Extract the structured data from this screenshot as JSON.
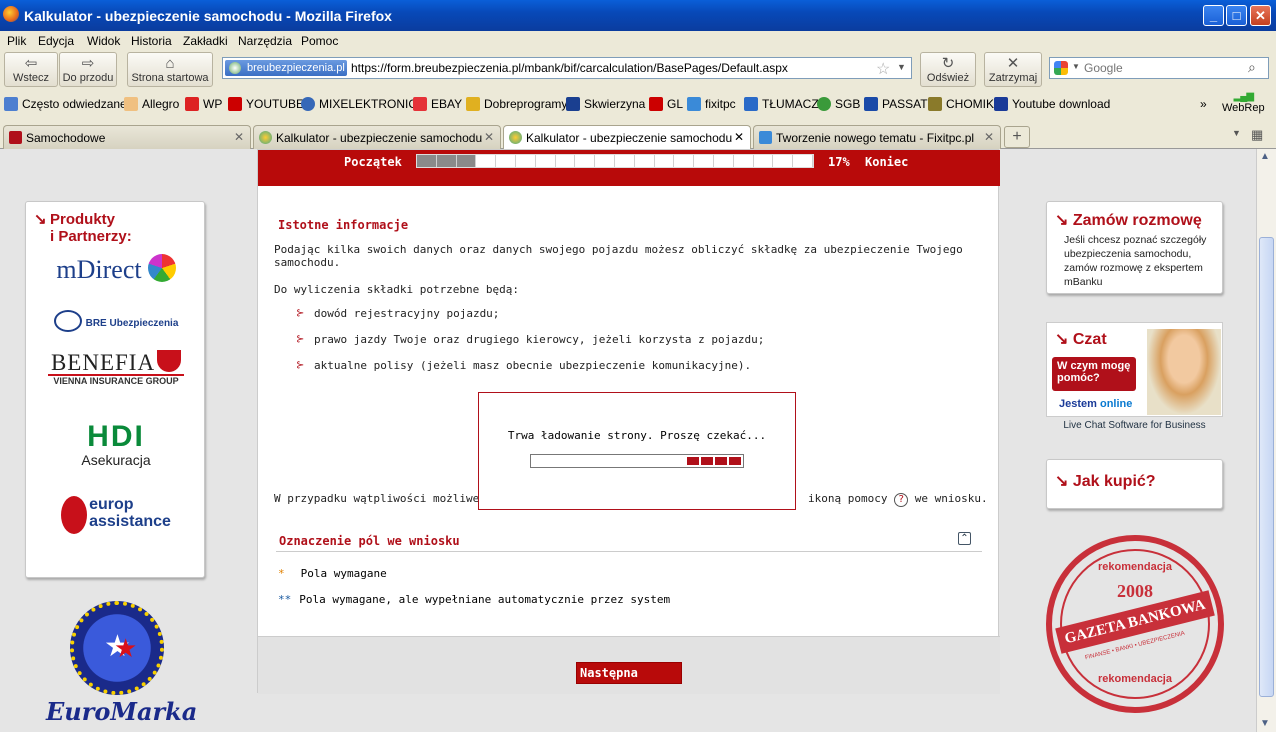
{
  "window": {
    "title": "Kalkulator - ubezpieczenie samochodu - Mozilla Firefox"
  },
  "menu": [
    "Plik",
    "Edycja",
    "Widok",
    "Historia",
    "Zakładki",
    "Narzędzia",
    "Pomoc"
  ],
  "nav": {
    "back": "Wstecz",
    "forward": "Do przodu",
    "home": "Strona startowa",
    "reload": "Odśwież",
    "stop": "Zatrzymaj"
  },
  "address": {
    "site_badge": "breubezpieczenia.pl",
    "url": "https://form.breubezpieczenia.pl/mbank/bif/carcalculation/BasePages/Default.aspx"
  },
  "search": {
    "placeholder": "Google"
  },
  "bookmarks": [
    "Często odwiedzane",
    "Allegro",
    "WP",
    "YOUTUBE",
    "MIXELEKTRONICS",
    "EBAY",
    "Dobreprogramy",
    "Skwierzyna",
    "GL",
    "fixitpc",
    "TŁUMACZ",
    "SGB",
    "PASSAT",
    "CHOMIK",
    "Youtube download"
  ],
  "bookmarks_extra": {
    "chevron": "»",
    "webrep": "WebRep"
  },
  "tabs": [
    {
      "label": "Samochodowe",
      "active": false
    },
    {
      "label": "Kalkulator - ubezpieczenie samochodu",
      "active": false
    },
    {
      "label": "Kalkulator - ubezpieczenie samochodu",
      "active": true
    },
    {
      "label": "Tworzenie nowego tematu - Fixitpc.pl",
      "active": false
    }
  ],
  "progress": {
    "start": "Początek",
    "percent": "17%",
    "end": "Koniec",
    "fraction": 0.17,
    "segments": 20,
    "filled": 3
  },
  "left": {
    "title_line1": "Produkty",
    "title_line2": "i Partnerzy:",
    "partners": {
      "mdirect": "mDirect",
      "bre": "BRE Ubezpieczenia",
      "benefia": "BENEFIA",
      "benefia_sub": "VIENNA INSURANCE GROUP",
      "hdi": "HDI",
      "hdi_sub": "Asekuracja",
      "europ1": "europ",
      "europ2": "assistance",
      "euromarka": "EuroMarka"
    }
  },
  "main": {
    "info_title": "Istotne informacje",
    "intro": "Podając kilka swoich danych oraz danych swojego pojazdu możesz obliczyć składkę za ubezpieczenie Twojego samochodu.",
    "needed": "Do wyliczenia składki potrzebne będą:",
    "items": [
      "dowód rejestracyjny pojazdu;",
      "prawo jazdy Twoje oraz drugiego kierowcy, jeżeli korzysta z pojazdu;",
      "aktualne polisy (jeżeli masz obecnie ubezpieczenie komunikacyjne)."
    ],
    "help_left": "W przypadku wątpliwości możliwe je",
    "help_right": "ikoną pomocy",
    "help_end": "we wniosku.",
    "help_icon": "?",
    "legend_title": "Oznaczenie pól we wniosku",
    "legend": [
      {
        "mark": "*",
        "text": "Pola wymagane"
      },
      {
        "mark": "**",
        "text": "Pola wymagane, ale wypełniane automatycznie przez system"
      }
    ],
    "next": "Następna"
  },
  "loader": {
    "text": "Trwa ładowanie strony. Proszę czekać..."
  },
  "right": {
    "order_title": "Zamów rozmowę",
    "order_text": "Jeśli chcesz poznać szczegóły ubezpieczenia samochodu, zamów rozmowę z ekspertem mBanku",
    "chat_title": "Czat",
    "chat_bubble": "W czym mogę pomóc?",
    "chat_online_1": "Jestem",
    "chat_online_2": "online",
    "chat_caption": "Live Chat Software for Business",
    "buy_title": "Jak kupić?",
    "stamp": {
      "top": "rekomendacja",
      "year": "2008",
      "name": "GAZETA BANKOWA",
      "sub": "FINANSE • BANKI • UBEZPIECZENIA"
    }
  },
  "colors": {
    "brand_red": "#b80a0a",
    "titlebar": "#0a5fd8"
  }
}
